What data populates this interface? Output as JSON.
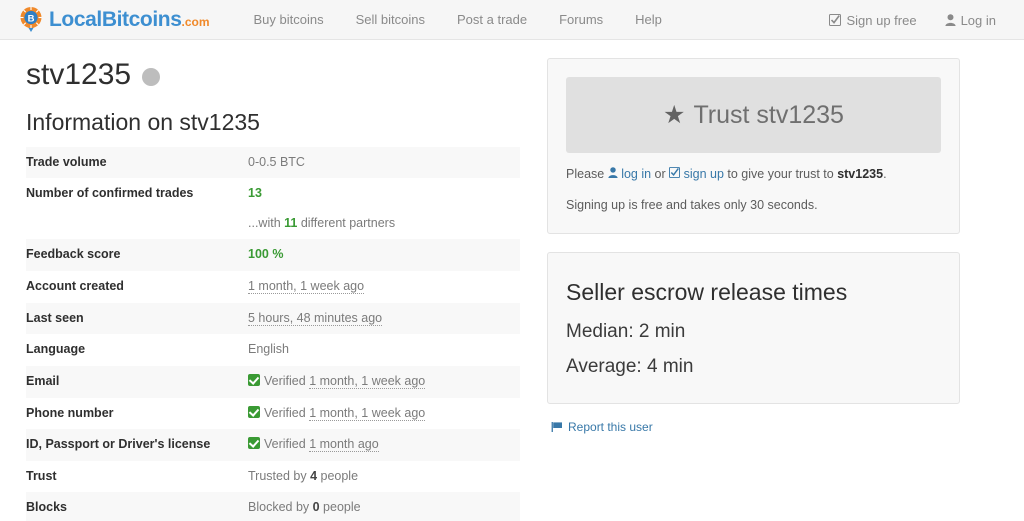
{
  "header": {
    "brand": {
      "name": "LocalBitcoins",
      "suffix": ".com",
      "icon": "bitcoin-pin-logo"
    },
    "nav": [
      {
        "label": "Buy bitcoins",
        "name": "nav-buy-bitcoins"
      },
      {
        "label": "Sell bitcoins",
        "name": "nav-sell-bitcoins"
      },
      {
        "label": "Post a trade",
        "name": "nav-post-a-trade"
      },
      {
        "label": "Forums",
        "name": "nav-forums"
      },
      {
        "label": "Help",
        "name": "nav-help"
      }
    ],
    "signup": {
      "label": "Sign up free",
      "icon": "check-square-icon"
    },
    "login": {
      "label": "Log in",
      "icon": "user-icon"
    }
  },
  "profile": {
    "username": "stv1235",
    "status": "offline",
    "section_title": "Information on stv1235",
    "rows": [
      {
        "key": "Trade volume",
        "value": "0-0.5 BTC"
      },
      {
        "key": "Number of confirmed trades",
        "value": "13",
        "sub_prefix": "...with ",
        "sub_count": "11",
        "sub_suffix": " different partners"
      },
      {
        "key": "Feedback score",
        "value": "100 %"
      },
      {
        "key": "Account created",
        "value": "1 month, 1 week ago"
      },
      {
        "key": "Last seen",
        "value": "5 hours, 48 minutes ago"
      },
      {
        "key": "Language",
        "value": "English"
      },
      {
        "key": "Email",
        "verified_label": "Verified",
        "value": "1 month, 1 week ago"
      },
      {
        "key": "Phone number",
        "verified_label": "Verified",
        "value": "1 month, 1 week ago"
      },
      {
        "key": "ID, Passport or Driver's license",
        "verified_label": "Verified",
        "value": "1 month ago"
      },
      {
        "key": "Trust",
        "prefix": "Trusted by ",
        "count": "4",
        "suffix": " people"
      },
      {
        "key": "Blocks",
        "prefix": "Blocked by ",
        "count": "0",
        "suffix": " people"
      }
    ]
  },
  "trust_panel": {
    "button_label": "Trust stv1235",
    "button_icon": "star-icon",
    "note_prefix": "Please ",
    "login_link": "log in",
    "login_icon": "user-icon",
    "note_or": " or ",
    "signup_link": "sign up",
    "signup_icon": "check-square-icon",
    "note_middle": " to give your trust to ",
    "note_username": "stv1235",
    "note_period": ".",
    "note_second": "Signing up is free and takes only 30 seconds."
  },
  "escrow_panel": {
    "title": "Seller escrow release times",
    "median": "Median: 2 min",
    "average": "Average: 4 min"
  },
  "report": {
    "label": "Report this user",
    "icon": "flag-icon"
  },
  "colors": {
    "brand_blue": "#3d8fd1",
    "brand_orange": "#f0892a",
    "green": "#3a9a34",
    "link_blue": "#3878a8",
    "header_bg": "#f6f6f6",
    "panel_bg": "#f8f8f8"
  }
}
